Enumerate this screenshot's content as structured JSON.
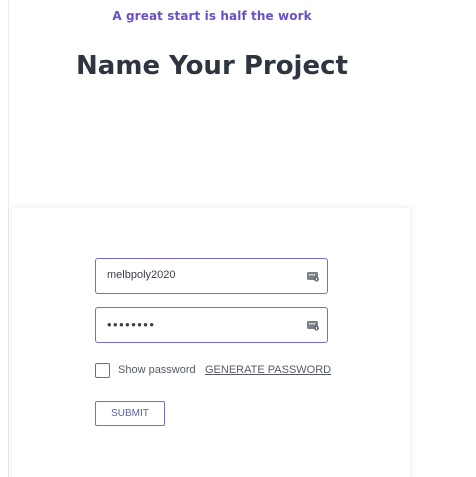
{
  "header": {
    "tagline": "A great start is half the work",
    "title": "Name Your Project"
  },
  "form": {
    "username": {
      "value": "melbpoly2020",
      "icon": "password-key-icon"
    },
    "password": {
      "value": "••••••••",
      "icon": "password-key-icon"
    },
    "show_password_label": "Show password",
    "show_password_checked": false,
    "generate_password_label": "GENERATE PASSWORD",
    "submit_label": "SUBMIT"
  },
  "colors": {
    "accent": "#6a4fc8",
    "field_border": "#7a6ad6",
    "title": "#2e3440"
  }
}
